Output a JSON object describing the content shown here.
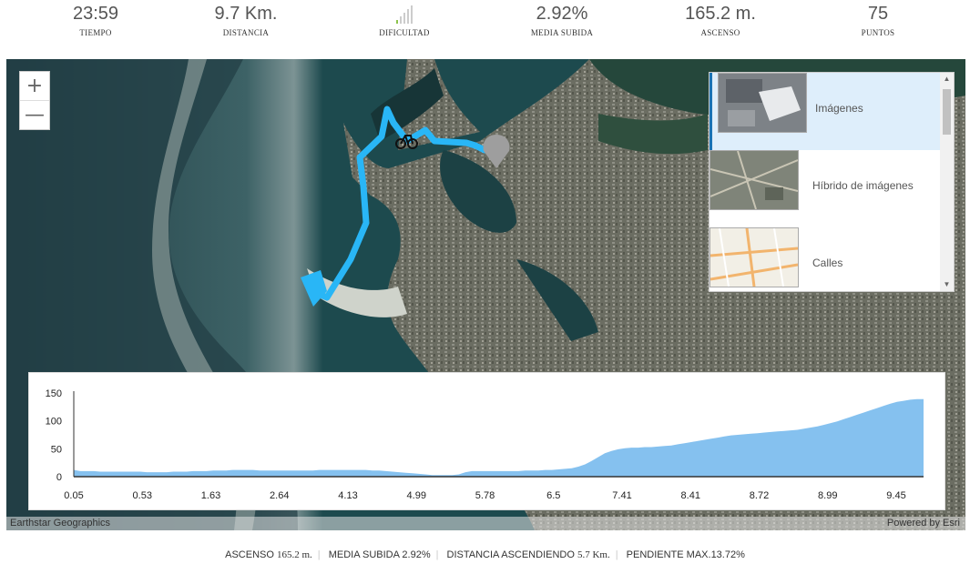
{
  "stats": [
    {
      "value": "23:59",
      "label": "TIEMPO"
    },
    {
      "value": "9.7 Km.",
      "label": "DISTANCIA"
    },
    {
      "value": "",
      "label": "DIFICULTAD"
    },
    {
      "value": "2.92%",
      "label": "MEDIA SUBIDA"
    },
    {
      "value": "165.2 m.",
      "label": "ASCENSO"
    },
    {
      "value": "75",
      "label": "PUNTOS"
    }
  ],
  "difficulty_level": 1,
  "colors": {
    "route": "#29b6f6",
    "difficulty_active": "#8bc34a",
    "elevation_fill": "#85c1ef"
  },
  "map": {
    "zoom_in": "+",
    "zoom_out": "—",
    "attribution_left": "Earthstar Geographics",
    "attribution_right": "Powered by Esri"
  },
  "basemap_gallery": [
    {
      "label": "Imágenes",
      "selected": true
    },
    {
      "label": "Híbrido de imágenes",
      "selected": false
    },
    {
      "label": "Calles",
      "selected": false
    }
  ],
  "chart_data": {
    "type": "area",
    "y_ticks": [
      0,
      50,
      100,
      150
    ],
    "x_tick_labels": [
      "0.05",
      "0.53",
      "1.63",
      "2.64",
      "4.13",
      "4.99",
      "5.78",
      "6.5",
      "7.41",
      "8.41",
      "8.72",
      "8.99",
      "9.45"
    ],
    "ylim": [
      0,
      150
    ],
    "values": [
      12,
      10,
      10,
      10,
      9,
      9,
      9,
      9,
      9,
      9,
      9,
      8,
      8,
      8,
      8,
      9,
      9,
      9,
      10,
      10,
      10,
      11,
      11,
      11,
      12,
      12,
      12,
      12,
      11,
      11,
      11,
      11,
      11,
      11,
      11,
      11,
      11,
      12,
      12,
      12,
      12,
      12,
      12,
      12,
      12,
      11,
      11,
      10,
      9,
      8,
      7,
      6,
      5,
      4,
      3,
      3,
      3,
      3,
      4,
      8,
      10,
      10,
      10,
      10,
      10,
      10,
      10,
      10,
      11,
      11,
      11,
      12,
      12,
      13,
      14,
      15,
      18,
      22,
      28,
      35,
      42,
      46,
      49,
      51,
      52,
      52,
      53,
      53,
      54,
      55,
      56,
      58,
      60,
      62,
      64,
      66,
      68,
      70,
      72,
      74,
      75,
      76,
      77,
      78,
      79,
      80,
      81,
      82,
      83,
      84,
      86,
      88,
      90,
      93,
      96,
      99,
      103,
      107,
      111,
      115,
      119,
      123,
      127,
      131,
      134,
      136,
      138,
      139,
      139
    ]
  },
  "footer": {
    "ascenso_label": "ASCENSO",
    "ascenso_value": "165.2 m.",
    "media_label": "MEDIA SUBIDA",
    "media_value": "2.92%",
    "distancia_label": "DISTANCIA ASCENDIENDO",
    "distancia_value": "5.7 Km.",
    "pendiente_label": "PENDIENTE MAX.",
    "pendiente_value": "13.72%"
  }
}
